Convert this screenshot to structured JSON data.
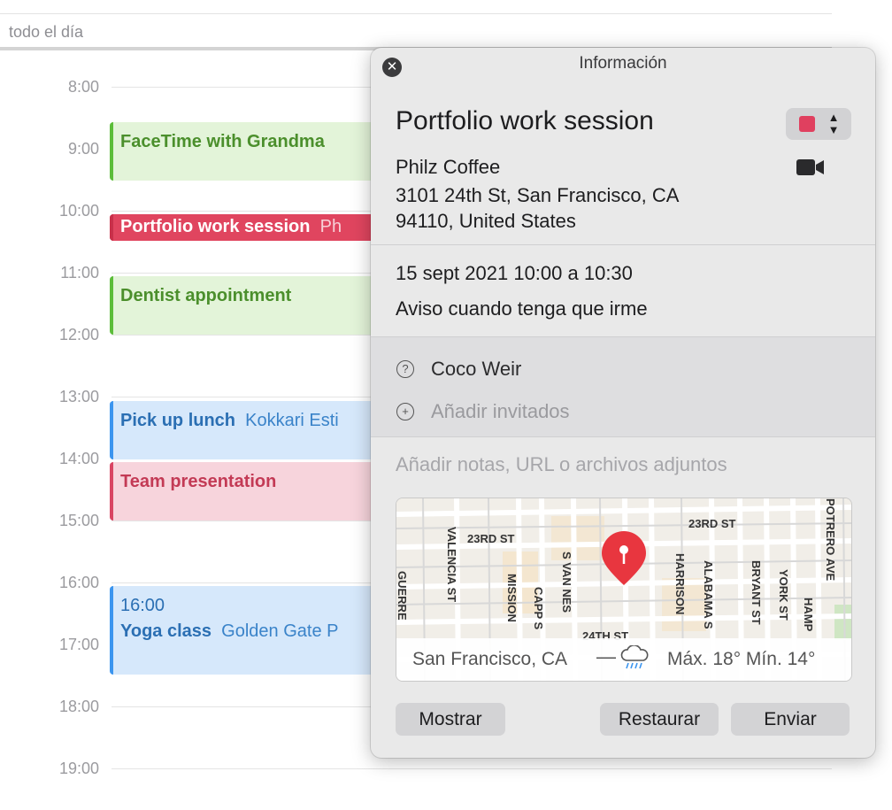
{
  "calendar": {
    "all_day_label": "todo el día",
    "hours": [
      "8:00",
      "9:00",
      "10:00",
      "11:00",
      "12:00",
      "13:00",
      "14:00",
      "15:00",
      "16:00",
      "17:00",
      "18:00",
      "19:00"
    ],
    "events": [
      {
        "title": "FaceTime with Grandma",
        "location": "",
        "color": "#5cbd3a"
      },
      {
        "title": "Portfolio work session",
        "location": "Ph",
        "color": "#e0455f"
      },
      {
        "title": "Dentist appointment",
        "location": "",
        "color": "#5cbd3a"
      },
      {
        "title": "Pick up lunch",
        "location": "Kokkari Esti",
        "color": "#3b95ef"
      },
      {
        "title": "Team presentation",
        "location": "",
        "color": "#d94563"
      },
      {
        "time": "16:00",
        "title": "Yoga class",
        "location": "Golden Gate P",
        "color": "#3b95ef"
      }
    ]
  },
  "inspector": {
    "window_title": "Información",
    "event_title": "Portfolio work session",
    "calendar_color": "#e0405f",
    "location_name": "Philz Coffee",
    "address_line1": "3101 24th St, San Francisco, CA",
    "address_line2": "94110, United States",
    "date_time": "15 sept 2021 10:00 a 10:30",
    "alert": "Aviso cuando tenga que irme",
    "organizer": "Coco Weir",
    "add_invitees_placeholder": "Añadir invitados",
    "notes_placeholder": "Añadir notas, URL o archivos adjuntos",
    "map": {
      "street_labels": [
        "23RD ST",
        "23RD ST",
        "VALENCIA ST",
        "MISSION",
        "CAPP S",
        "S VAN NES",
        "HARRISON",
        "ALABAMA S",
        "BRYANT ST",
        "YORK ST",
        "HAMP",
        "POTRERO AVE",
        "GUERRE",
        "24TH ST"
      ],
      "weather_city": "San Francisco, CA",
      "weather_dash": "—",
      "weather_icon": "rain-cloud-icon",
      "weather_temps": "Máx. 18° Mín. 14°"
    },
    "buttons": {
      "show": "Mostrar",
      "revert": "Restaurar",
      "send": "Enviar"
    }
  }
}
